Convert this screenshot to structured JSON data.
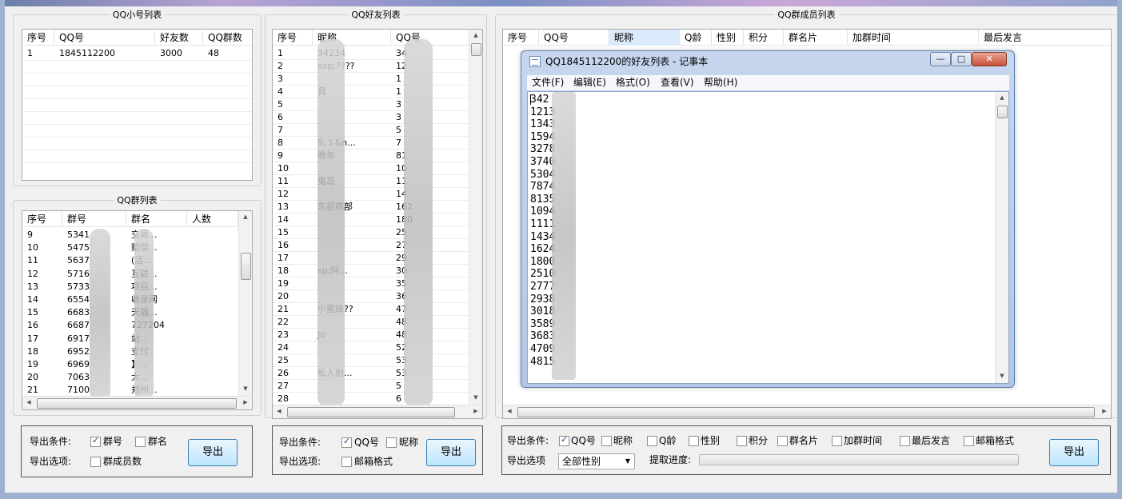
{
  "accounts_panel": {
    "title": "QQ小号列表",
    "columns": [
      "序号",
      "QQ号",
      "好友数",
      "QQ群数"
    ],
    "rows": [
      [
        "1",
        "1845112200",
        "3000",
        "48"
      ]
    ]
  },
  "groups_panel": {
    "title": "QQ群列表",
    "columns": [
      "序号",
      "群号",
      "群名",
      "人数"
    ],
    "rows": [
      [
        "9",
        "5341",
        "交易..."
      ],
      [
        "10",
        "5475",
        "赔偿..."
      ],
      [
        "11",
        "5637",
        "(活..."
      ],
      [
        "12",
        "5716",
        "互联..."
      ],
      [
        "13",
        "5733",
        "项目..."
      ],
      [
        "14",
        "6554",
        "收录网"
      ],
      [
        "15",
        "6683",
        "天猫..."
      ],
      [
        "16",
        "6687",
        "727204"
      ],
      [
        "17",
        "6917",
        "站..."
      ],
      [
        "18",
        "6952",
        "支付"
      ],
      [
        "19",
        "6969",
        "】..."
      ],
      [
        "20",
        "7063",
        "大..."
      ],
      [
        "21",
        "7100",
        "郑州..."
      ]
    ]
  },
  "friends_panel": {
    "title": "QQ好友列表",
    "columns": [
      "序号",
      "昵称",
      "QQ号"
    ],
    "rows": [
      [
        "1",
        "34234",
        "34"
      ],
      [
        "2",
        "osp;????",
        "12"
      ],
      [
        "3",
        "",
        "1"
      ],
      [
        "4",
        "具",
        "1"
      ],
      [
        "5",
        "",
        "3"
      ],
      [
        "6",
        "",
        "3"
      ],
      [
        "7",
        "",
        "5"
      ],
      [
        "8",
        "9;ゞ&n...",
        "7"
      ],
      [
        "9",
        "瞻年",
        "81"
      ],
      [
        "10",
        "",
        "10"
      ],
      [
        "11",
        "鬼岛",
        "11"
      ],
      [
        "12",
        "",
        "14"
      ],
      [
        "13",
        "东招商部",
        "162"
      ],
      [
        "14",
        "",
        "180"
      ],
      [
        "15",
        "",
        "25"
      ],
      [
        "16",
        "",
        "27"
      ],
      [
        "17",
        "",
        "29"
      ],
      [
        "18",
        "sp;阿...",
        "30"
      ],
      [
        "19",
        "",
        "35"
      ],
      [
        "20",
        "",
        "36"
      ],
      [
        "21",
        "小蜜蜂??",
        "47"
      ],
      [
        "22",
        "",
        "48"
      ],
      [
        "23",
        "Jo",
        "48"
      ],
      [
        "24",
        "",
        "52"
      ],
      [
        "25",
        "",
        "53"
      ],
      [
        "26",
        "私人耐...",
        "53"
      ],
      [
        "27",
        "",
        "5"
      ],
      [
        "28",
        "",
        "6"
      ]
    ]
  },
  "members_panel": {
    "title": "QQ群成员列表",
    "columns": [
      "序号",
      "QQ号",
      "昵称",
      "Q龄",
      "性别",
      "积分",
      "群名片",
      "加群时间",
      "最后发言"
    ]
  },
  "notepad": {
    "title": "QQ1845112200的好友列表 - 记事本",
    "menu": [
      "文件(F)",
      "编辑(E)",
      "格式(O)",
      "查看(V)",
      "帮助(H)"
    ],
    "minimize": "—",
    "maximize": "□",
    "close": "✕",
    "lines": [
      "342",
      "1213",
      "1343",
      "1594",
      "3278",
      "3740",
      "5304",
      "7874",
      "8135",
      "1094",
      "1111",
      "1434",
      "1624",
      "1800",
      "2510",
      "2777",
      "2938",
      "3018",
      "3589",
      "3683",
      "4709",
      "4815"
    ]
  },
  "groups_export": {
    "condition_label": "导出条件:",
    "option_label": "导出选项:",
    "cb_group_no": "群号",
    "cb_group_name": "群名",
    "cb_member_count": "群成员数",
    "button": "导出"
  },
  "friends_export": {
    "condition_label": "导出条件:",
    "option_label": "导出选项:",
    "cb_qq": "QQ号",
    "cb_nick": "昵称",
    "cb_mail": "邮箱格式",
    "button": "导出"
  },
  "members_export": {
    "condition_label": "导出条件:",
    "option_label": "导出选项",
    "cb_qq": "QQ号",
    "cb_nick": "昵称",
    "cb_age": "Q龄",
    "cb_gender": "性别",
    "cb_points": "积分",
    "cb_card": "群名片",
    "cb_join": "加群时间",
    "cb_last": "最后发言",
    "cb_mail": "邮箱格式",
    "gender_select": "全部性别",
    "progress_label": "提取进度:",
    "progress": 0,
    "button": "导出"
  }
}
